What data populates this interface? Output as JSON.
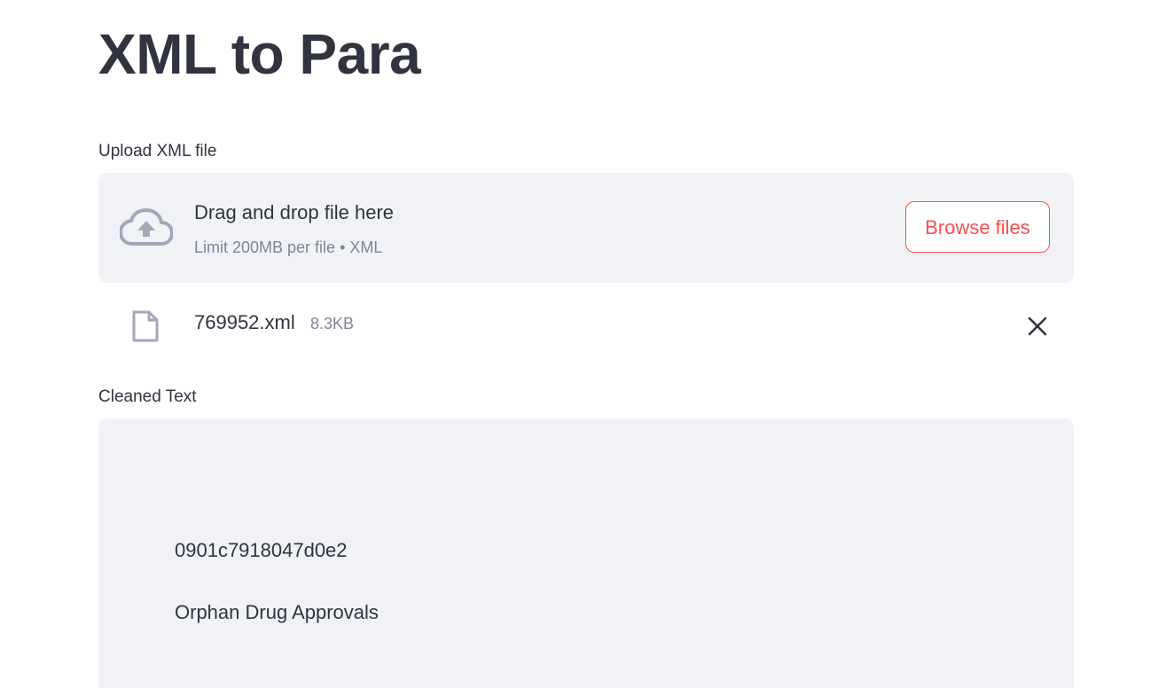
{
  "page": {
    "title": "XML to Para"
  },
  "uploader": {
    "label": "Upload XML file",
    "drop_title": "Drag and drop file here",
    "drop_subtitle": "Limit 200MB per file • XML",
    "browse_label": "Browse files",
    "icon": "cloud-upload-icon"
  },
  "uploaded_file": {
    "name": "769952.xml",
    "size": "8.3KB",
    "icon": "file-icon",
    "remove_icon": "close-icon"
  },
  "cleaned_text": {
    "label": "Cleaned Text",
    "lines": [
      "0901c7918047d0e2",
      "Orphan Drug Approvals"
    ]
  },
  "colors": {
    "accent": "#ff4b4b",
    "panel_bg": "#f0f2f6",
    "text": "#31333f",
    "muted": "#808495",
    "icon": "#a3a8b8"
  }
}
